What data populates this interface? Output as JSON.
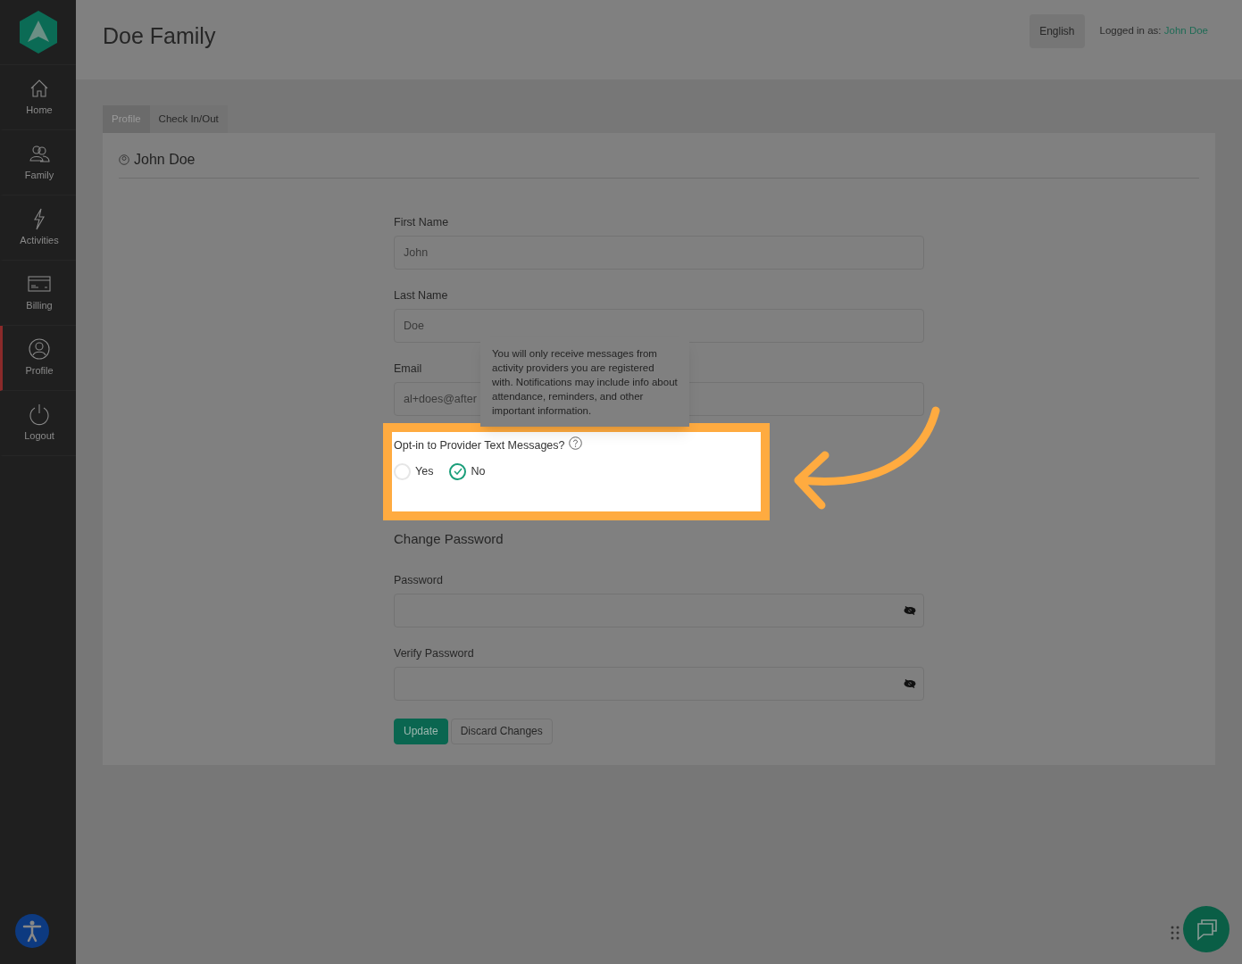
{
  "header": {
    "title": "Doe Family",
    "language": "English",
    "logged_in_label": "Logged in as:",
    "logged_in_user": "John Doe"
  },
  "sidebar": {
    "items": [
      {
        "label": "Home",
        "kind": "home",
        "selected": false
      },
      {
        "label": "Family",
        "kind": "family",
        "selected": false
      },
      {
        "label": "Activities",
        "kind": "bolt",
        "selected": false
      },
      {
        "label": "Billing",
        "kind": "card",
        "selected": false
      },
      {
        "label": "Profile",
        "kind": "profile",
        "selected": true
      },
      {
        "label": "Logout",
        "kind": "power",
        "selected": false
      }
    ]
  },
  "tabs": [
    {
      "label": "Profile",
      "selected": true
    },
    {
      "label": "Check In/Out",
      "selected": false
    }
  ],
  "card": {
    "title": "John Doe"
  },
  "fields": [
    {
      "label": "First Name",
      "value": "John"
    },
    {
      "label": "Last Name",
      "value": "Doe"
    },
    {
      "label": "Email",
      "value": "al+does@after"
    }
  ],
  "tooltip": "You will only receive messages from activity providers you are registered with. Notifications may include info about attendance, reminders, and other important information.",
  "opt_in": {
    "question": "Opt-in to Provider Text Messages?",
    "options": [
      {
        "label": "Yes",
        "selected": false
      },
      {
        "label": "No",
        "selected": true
      }
    ]
  },
  "password_section": {
    "heading": "Change Password",
    "fields": [
      {
        "label": "Password"
      },
      {
        "label": "Verify Password"
      }
    ]
  },
  "buttons": [
    {
      "label": "Update",
      "kind": "primary"
    },
    {
      "label": "Discard Changes",
      "kind": "secondary"
    }
  ]
}
